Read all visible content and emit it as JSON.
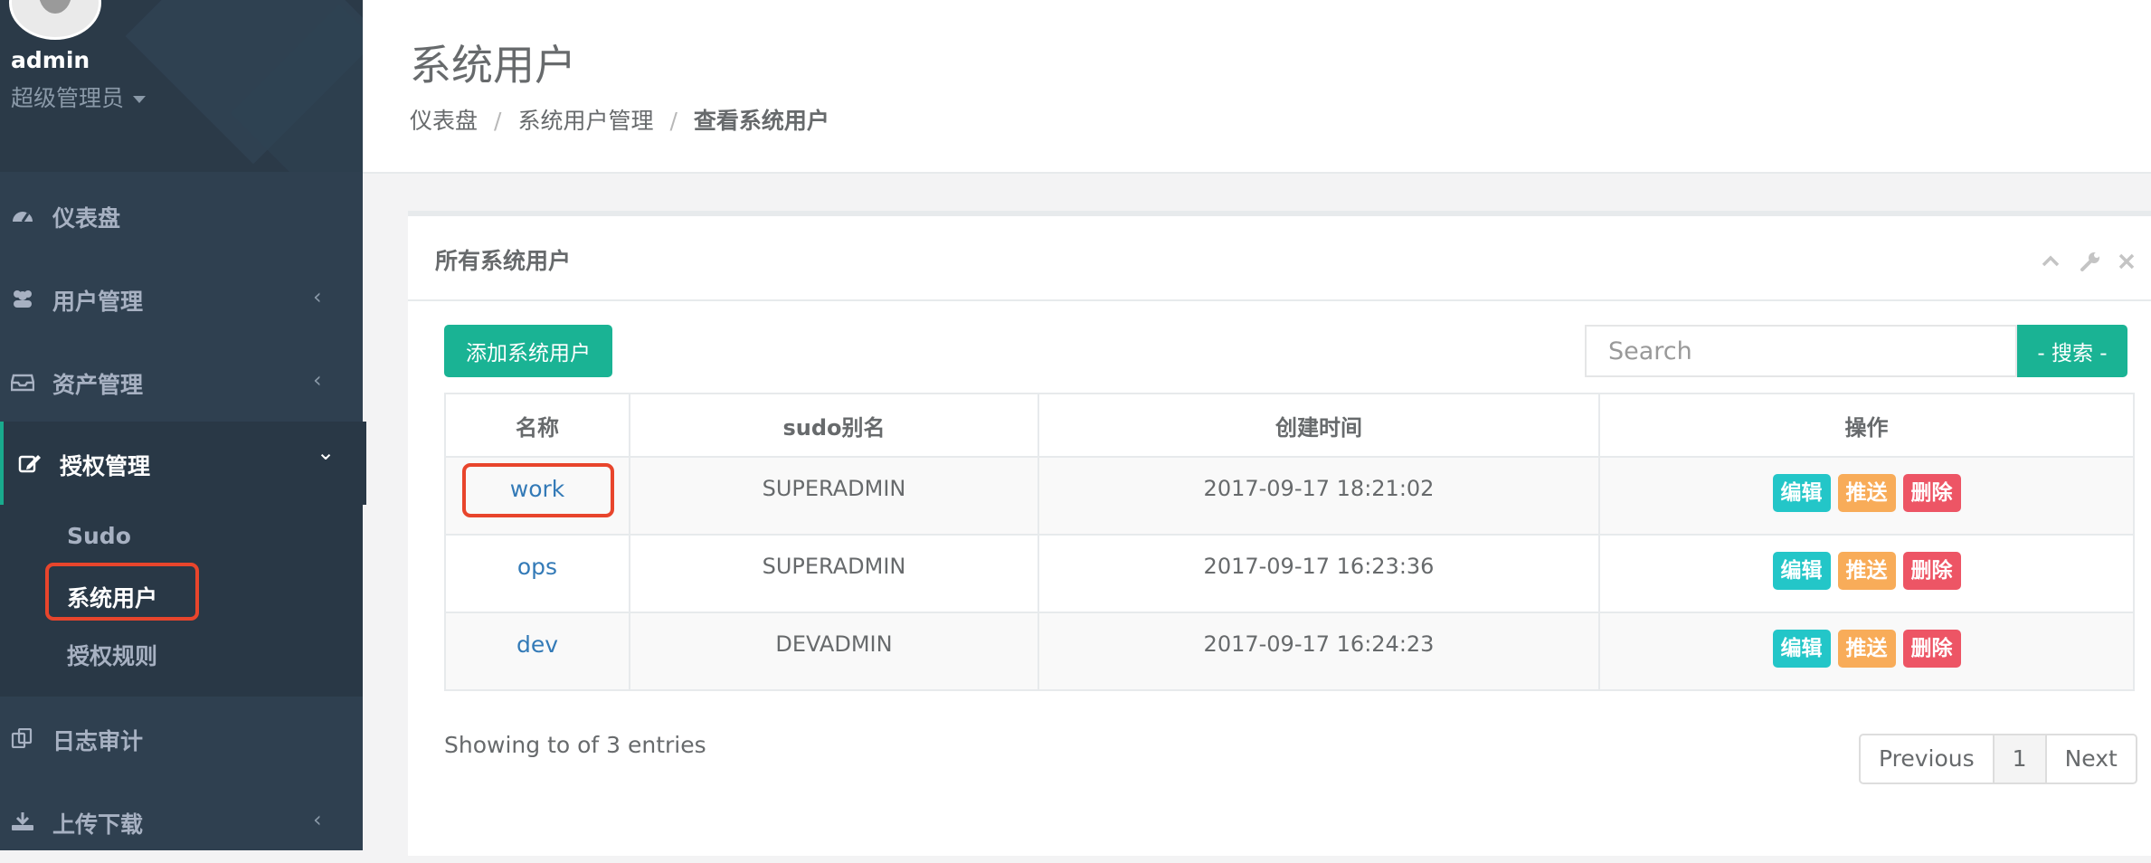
{
  "sidebar": {
    "user": {
      "name": "admin",
      "role": "超级管理员"
    },
    "menu": [
      {
        "label": "仪表盘"
      },
      {
        "label": "用户管理",
        "arrow": "‹"
      },
      {
        "label": "资产管理",
        "arrow": "‹"
      },
      {
        "label": "授权管理",
        "arrow": "⌄"
      },
      {
        "label": "日志审计"
      },
      {
        "label": "上传下载",
        "arrow": "‹"
      }
    ],
    "submenu": [
      {
        "label": "Sudo"
      },
      {
        "label": "系统用户"
      },
      {
        "label": "授权规则"
      }
    ]
  },
  "header": {
    "title": "系统用户",
    "breadcrumb": [
      "仪表盘",
      "系统用户管理",
      "查看系统用户"
    ],
    "separator": "/"
  },
  "panel": {
    "title": "所有系统用户",
    "add_button": "添加系统用户",
    "search_placeholder": "Search",
    "search_button": "- 搜索 -",
    "columns": [
      "名称",
      "sudo别名",
      "创建时间",
      "操作"
    ],
    "rows": [
      {
        "name": "work",
        "sudo": "SUPERADMIN",
        "created": "2017-09-17 18:21:02"
      },
      {
        "name": "ops",
        "sudo": "SUPERADMIN",
        "created": "2017-09-17 16:23:36"
      },
      {
        "name": "dev",
        "sudo": "DEVADMIN",
        "created": "2017-09-17 16:24:23"
      }
    ],
    "actions": {
      "edit": "编辑",
      "push": "推送",
      "delete": "删除"
    },
    "info": "Showing to of 3 entries",
    "pagination": {
      "previous": "Previous",
      "page": "1",
      "next": "Next"
    }
  },
  "colors": {
    "sidebar": "#2f4050",
    "primary": "#1ab394",
    "info": "#23c6c8",
    "warning": "#f8ac59",
    "danger": "#ed5565",
    "highlight": "#e8452c"
  }
}
